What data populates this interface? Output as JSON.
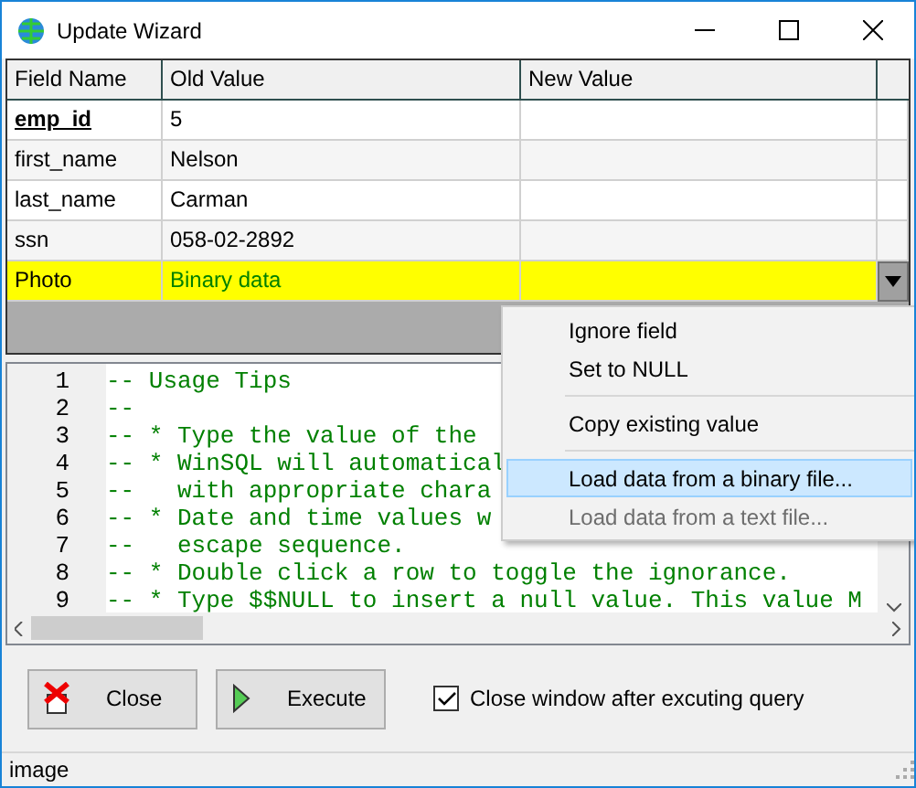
{
  "window": {
    "title": "Update Wizard"
  },
  "grid": {
    "columns": [
      "Field Name",
      "Old Value",
      "New Value"
    ],
    "rows": [
      {
        "field": "emp_id",
        "old": "5",
        "new": "",
        "key": true,
        "selected": false
      },
      {
        "field": "first_name",
        "old": "Nelson",
        "new": "",
        "key": false,
        "selected": false
      },
      {
        "field": "last_name",
        "old": "Carman",
        "new": "",
        "key": false,
        "selected": false
      },
      {
        "field": "ssn",
        "old": "058-02-2892",
        "new": "",
        "key": false,
        "selected": false
      },
      {
        "field": "Photo",
        "old": "Binary data",
        "new": "",
        "key": false,
        "selected": true
      }
    ]
  },
  "editor": {
    "lines": [
      {
        "number": "1",
        "text": "-- Usage Tips"
      },
      {
        "number": "2",
        "text": "--"
      },
      {
        "number": "3",
        "text": "-- * Type the value of the"
      },
      {
        "number": "4",
        "text": "-- * WinSQL will automatical"
      },
      {
        "number": "5",
        "text": "--   with appropriate chara"
      },
      {
        "number": "6",
        "text": "-- * Date and time values w"
      },
      {
        "number": "7",
        "text": "--   escape sequence."
      },
      {
        "number": "8",
        "text": "-- * Double click a row to toggle the ignorance."
      },
      {
        "number": "9",
        "text": "-- * Type $$NULL to insert a null value. This value M"
      }
    ]
  },
  "context_menu": {
    "items": [
      {
        "label": "Ignore field",
        "kind": "item",
        "selected": false,
        "disabled": false
      },
      {
        "label": "Set to NULL",
        "kind": "item",
        "selected": false,
        "disabled": false
      },
      {
        "kind": "separator"
      },
      {
        "label": "Copy existing value",
        "kind": "item",
        "selected": false,
        "disabled": false
      },
      {
        "kind": "separator"
      },
      {
        "label": "Load data from a binary file...",
        "kind": "item",
        "selected": true,
        "disabled": false
      },
      {
        "label": "Load data from a text file...",
        "kind": "item",
        "selected": false,
        "disabled": true
      }
    ]
  },
  "buttons": [
    {
      "label": "Close",
      "kind": "close"
    },
    {
      "label": "Execute",
      "kind": "execute"
    }
  ],
  "option": {
    "label": "Close window after excuting query",
    "checked": true
  },
  "status_bar": {
    "text": "image"
  }
}
